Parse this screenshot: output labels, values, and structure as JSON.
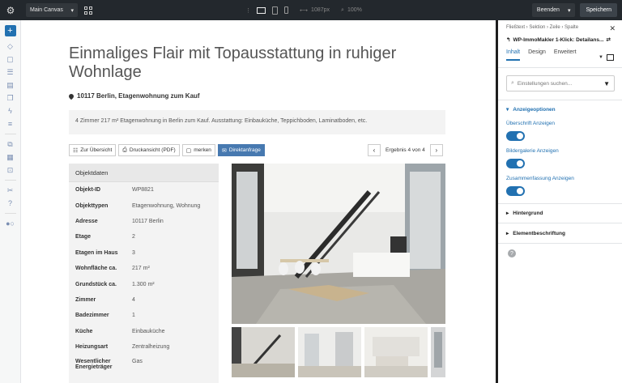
{
  "topbar": {
    "canvas_label": "Main Canvas",
    "width_value": "1087px",
    "zoom_value": "100%",
    "exit_label": "Beenden",
    "save_label": "Speichern"
  },
  "content": {
    "title": "Einmaliges Flair mit Topausstattung in ruhiger Wohnlage",
    "location": "10117 Berlin, Etagenwohnung zum Kauf",
    "summary": "4 Zimmer 217 m² Etagenwohnung in Berlin zum Kauf. Ausstattung: Einbauküche, Teppichboden, Laminatboden, etc.",
    "actions": [
      {
        "label": "Zur Übersicht"
      },
      {
        "label": "Druckansicht (PDF)"
      },
      {
        "label": "merken"
      },
      {
        "label": "Direktanfrage"
      }
    ],
    "pager_text": "Ergebnis 4 von 4",
    "objektdaten_title": "Objektdaten",
    "rows": [
      {
        "k": "Objekt-ID",
        "v": "WP8821"
      },
      {
        "k": "Objekttypen",
        "v": "Etagenwohnung, Wohnung"
      },
      {
        "k": "Adresse",
        "v": "10117 Berlin"
      },
      {
        "k": "Etage",
        "v": "2"
      },
      {
        "k": "Etagen im Haus",
        "v": "3"
      },
      {
        "k": "Wohnfläche ca.",
        "v": "217 m²"
      },
      {
        "k": "Grundstück ca.",
        "v": "1.300 m²"
      },
      {
        "k": "Zimmer",
        "v": "4"
      },
      {
        "k": "Badezimmer",
        "v": "1"
      },
      {
        "k": "Küche",
        "v": "Einbauküche"
      },
      {
        "k": "Heizungsart",
        "v": "Zentralheizung"
      },
      {
        "k": "Wesentlicher Energieträger",
        "v": "Gas"
      }
    ]
  },
  "panel": {
    "breadcrumb": "Fließtext › Sektion › Zeile › Spalte",
    "module_title": "WP-ImmoMakler 1-Klick: Detailans...",
    "tabs": [
      "Inhalt",
      "Design",
      "Erweitert"
    ],
    "search_placeholder": "Einstellungen suchen...",
    "section_open": "Anzeigeoptionen",
    "toggle_1": "Überschrift Anzeigen",
    "toggle_2": "Bildergalerie Anzeigen",
    "toggle_3": "Zusammenfassung Anzeigen",
    "section_bg": "Hintergrund",
    "section_label": "Elementbeschriftung"
  }
}
